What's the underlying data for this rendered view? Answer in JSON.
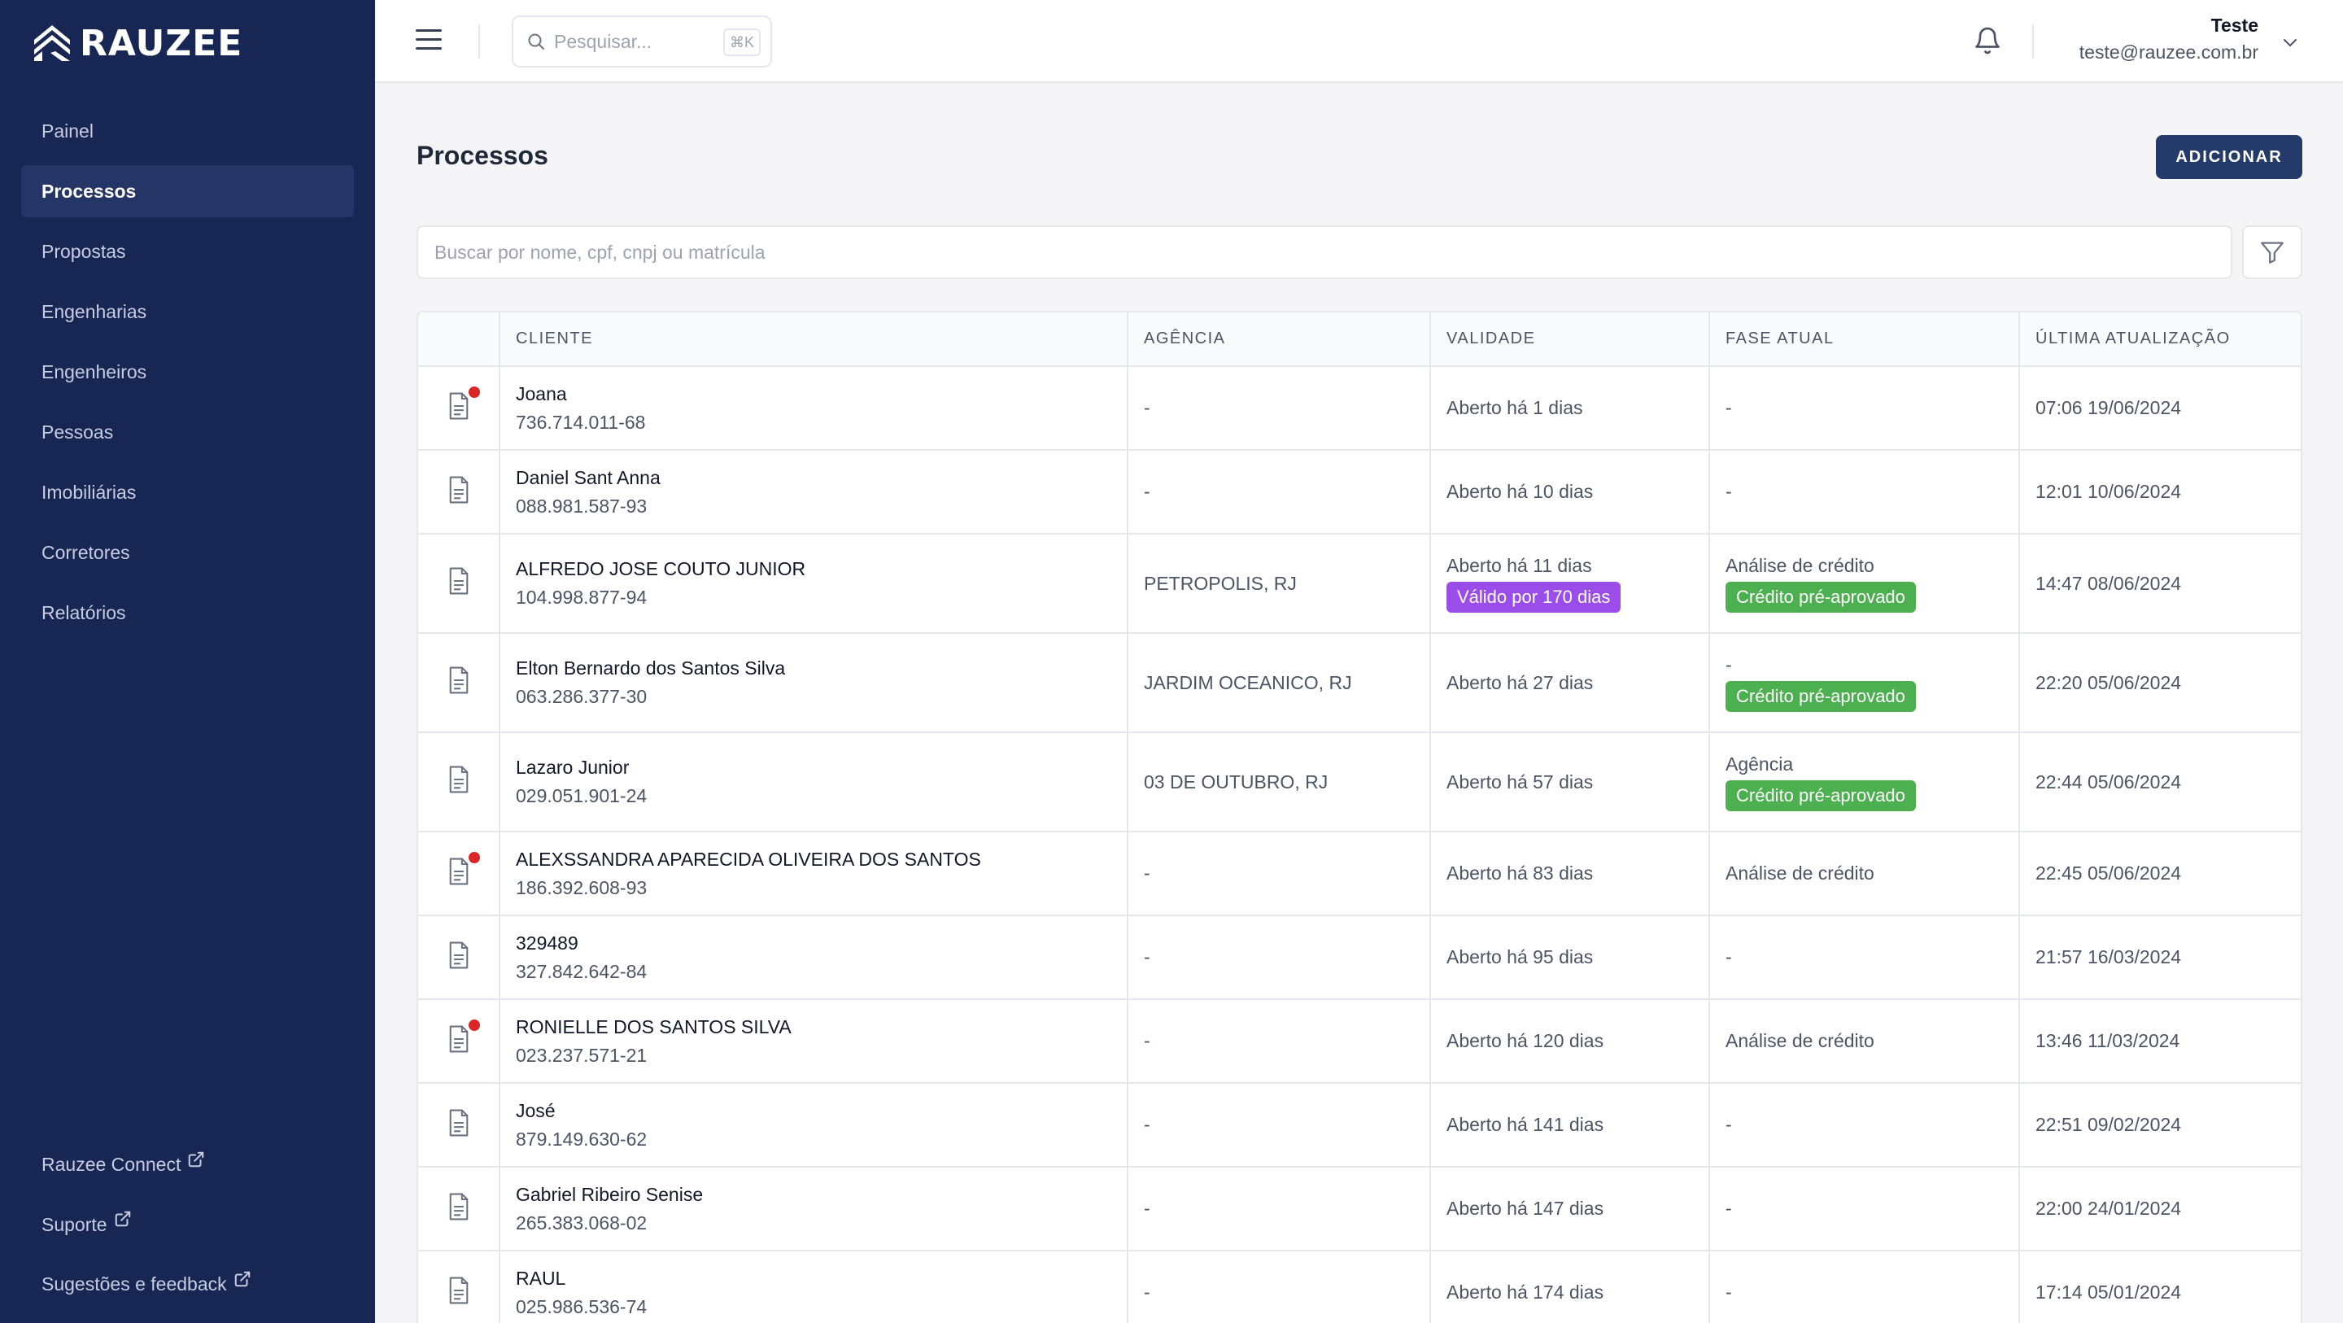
{
  "brand": {
    "name": "RAUZEE"
  },
  "sidebar": {
    "items": [
      {
        "label": "Painel",
        "active": false
      },
      {
        "label": "Processos",
        "active": true
      },
      {
        "label": "Propostas",
        "active": false
      },
      {
        "label": "Engenharias",
        "active": false
      },
      {
        "label": "Engenheiros",
        "active": false
      },
      {
        "label": "Pessoas",
        "active": false
      },
      {
        "label": "Imobiliárias",
        "active": false
      },
      {
        "label": "Corretores",
        "active": false
      },
      {
        "label": "Relatórios",
        "active": false
      }
    ],
    "footer": [
      {
        "label": "Rauzee Connect",
        "icon": "external-link-icon"
      },
      {
        "label": "Suporte",
        "icon": "external-link-icon"
      },
      {
        "label": "Sugestões e feedback",
        "icon": "external-link-icon"
      }
    ]
  },
  "topbar": {
    "search": {
      "placeholder": "Pesquisar...",
      "shortcut": "⌘K"
    },
    "user": {
      "name": "Teste",
      "email": "teste@rauzee.com.br"
    }
  },
  "main": {
    "title": "Processos",
    "add_label": "ADICIONAR",
    "filter_placeholder": "Buscar por nome, cpf, cnpj ou matrícula"
  },
  "table": {
    "columns": [
      "",
      "CLIENTE",
      "AGÊNCIA",
      "VALIDADE",
      "FASE ATUAL",
      "ÚLTIMA ATUALIZAÇÃO"
    ],
    "rows": [
      {
        "unread": true,
        "name": "Joana",
        "doc": "736.714.011-68",
        "agency": "-",
        "validity": "Aberto há 1 dias",
        "validity_badge": "",
        "phase": "-",
        "phase_badge": "",
        "updated": "07:06 19/06/2024"
      },
      {
        "unread": false,
        "name": "Daniel Sant Anna",
        "doc": "088.981.587-93",
        "agency": "-",
        "validity": "Aberto há 10 dias",
        "validity_badge": "",
        "phase": "-",
        "phase_badge": "",
        "updated": "12:01 10/06/2024"
      },
      {
        "unread": false,
        "name": "ALFREDO JOSE COUTO JUNIOR",
        "doc": "104.998.877-94",
        "agency": "PETROPOLIS, RJ",
        "validity": "Aberto há 11 dias",
        "validity_badge": "Válido por 170 dias",
        "phase": "Análise de crédito",
        "phase_badge": "Crédito pré-aprovado",
        "updated": "14:47 08/06/2024"
      },
      {
        "unread": false,
        "name": "Elton Bernardo dos Santos Silva",
        "doc": "063.286.377-30",
        "agency": "JARDIM OCEANICO, RJ",
        "validity": "Aberto há 27 dias",
        "validity_badge": "",
        "phase": "-",
        "phase_badge": "Crédito pré-aprovado",
        "updated": "22:20 05/06/2024"
      },
      {
        "unread": false,
        "name": "Lazaro Junior",
        "doc": "029.051.901-24",
        "agency": "03 DE OUTUBRO, RJ",
        "validity": "Aberto há 57 dias",
        "validity_badge": "",
        "phase": "Agência",
        "phase_badge": "Crédito pré-aprovado",
        "updated": "22:44 05/06/2024"
      },
      {
        "unread": true,
        "name": "ALEXSSANDRA APARECIDA OLIVEIRA DOS SANTOS",
        "doc": "186.392.608-93",
        "agency": "-",
        "validity": "Aberto há 83 dias",
        "validity_badge": "",
        "phase": "Análise de crédito",
        "phase_badge": "",
        "updated": "22:45 05/06/2024"
      },
      {
        "unread": false,
        "name": "329489",
        "doc": "327.842.642-84",
        "agency": "-",
        "validity": "Aberto há 95 dias",
        "validity_badge": "",
        "phase": "-",
        "phase_badge": "",
        "updated": "21:57 16/03/2024"
      },
      {
        "unread": true,
        "name": "RONIELLE DOS SANTOS SILVA",
        "doc": "023.237.571-21",
        "agency": "-",
        "validity": "Aberto há 120 dias",
        "validity_badge": "",
        "phase": "Análise de crédito",
        "phase_badge": "",
        "updated": "13:46 11/03/2024"
      },
      {
        "unread": false,
        "name": "José",
        "doc": "879.149.630-62",
        "agency": "-",
        "validity": "Aberto há 141 dias",
        "validity_badge": "",
        "phase": "-",
        "phase_badge": "",
        "updated": "22:51 09/02/2024"
      },
      {
        "unread": false,
        "name": "Gabriel Ribeiro Senise",
        "doc": "265.383.068-02",
        "agency": "-",
        "validity": "Aberto há 147 dias",
        "validity_badge": "",
        "phase": "-",
        "phase_badge": "",
        "updated": "22:00 24/01/2024"
      },
      {
        "unread": false,
        "name": "RAUL",
        "doc": "025.986.536-74",
        "agency": "-",
        "validity": "Aberto há 174 dias",
        "validity_badge": "",
        "phase": "-",
        "phase_badge": "",
        "updated": "17:14 05/01/2024"
      }
    ]
  },
  "colors": {
    "sidebar_bg": "#182654",
    "accent": "#233a6a",
    "badge_purple": "#9b4dea",
    "badge_green": "#4caf50",
    "unread_dot": "#dc2626"
  }
}
